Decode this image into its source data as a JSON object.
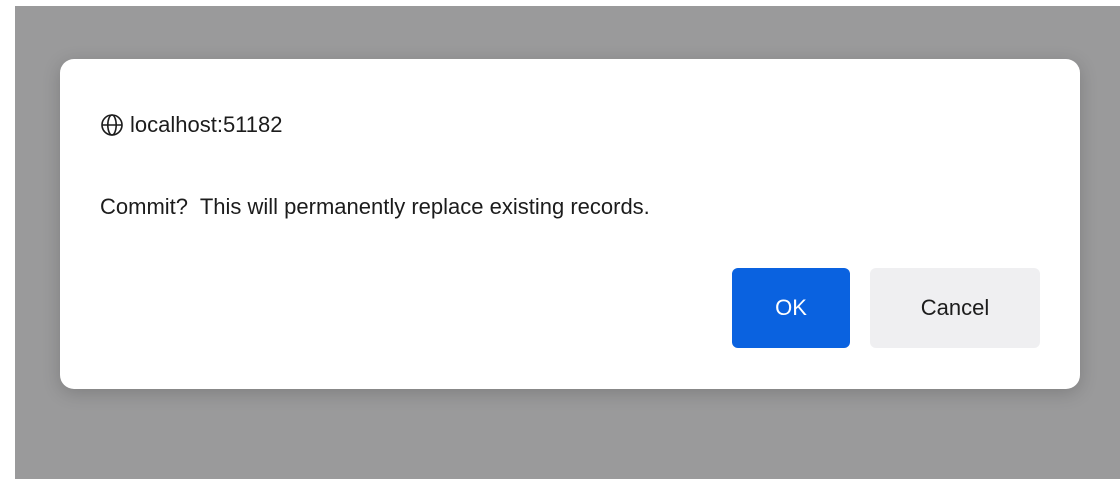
{
  "dialog": {
    "origin": "localhost:51182",
    "origin_icon": "globe-icon",
    "message": "Commit?  This will permanently replace existing records.",
    "ok_label": "OK",
    "cancel_label": "Cancel"
  },
  "colors": {
    "backdrop": "#9a9a9b",
    "primary_button": "#0a62e0",
    "secondary_button": "#efeff1"
  }
}
